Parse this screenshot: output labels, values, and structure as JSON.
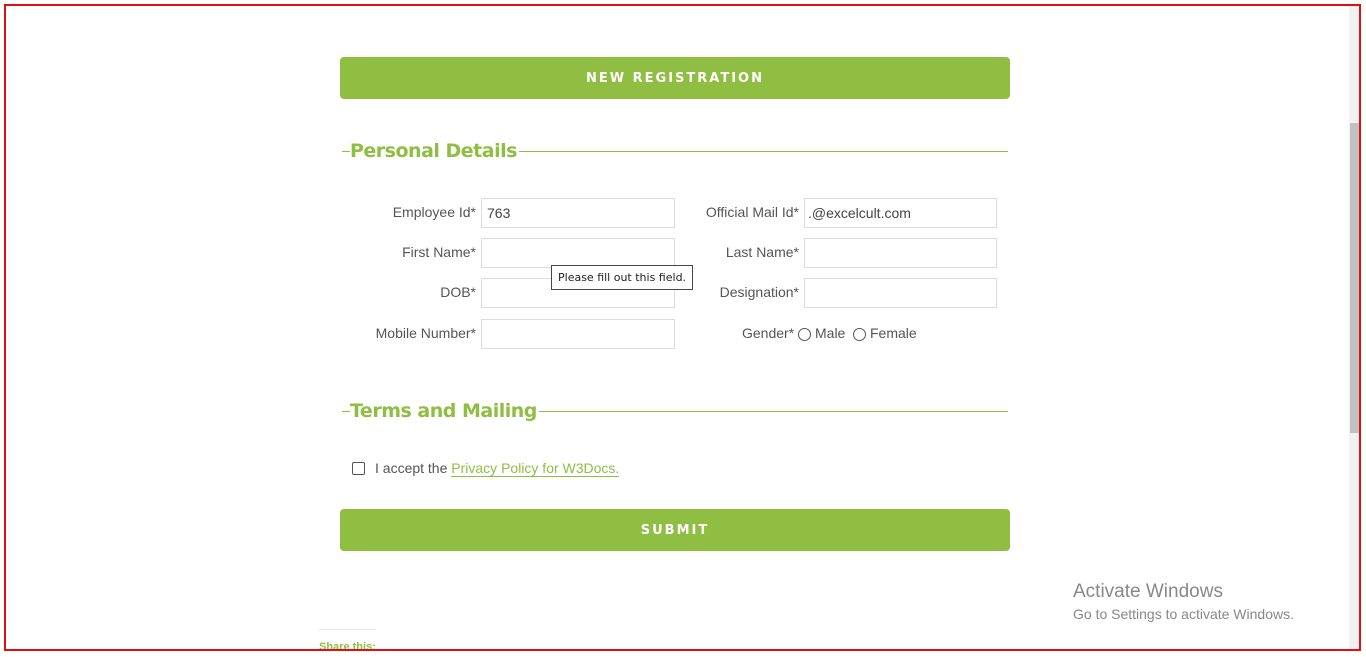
{
  "header_button": "NEW REGISTRATION",
  "personal_section": "Personal Details",
  "fields": {
    "employee_id": {
      "label": "Employee Id*",
      "value": "763"
    },
    "official_mail": {
      "label": "Official Mail Id*",
      "value": ".@excelcult.com"
    },
    "first_name": {
      "label": "First Name*",
      "value": ""
    },
    "last_name": {
      "label": "Last Name*",
      "value": ""
    },
    "dob": {
      "label": "DOB*",
      "value": ""
    },
    "designation": {
      "label": "Designation*",
      "value": ""
    },
    "mobile": {
      "label": "Mobile Number*",
      "value": ""
    },
    "gender": {
      "label": "Gender*",
      "options": [
        "Male",
        "Female"
      ]
    }
  },
  "tooltip": "Please fill out this field.",
  "terms_section": "Terms and Mailing",
  "accept": {
    "prefix": "I accept the",
    "link": "Privacy Policy for W3Docs."
  },
  "submit_button": "SUBMIT",
  "share": "Share this:",
  "watermark": {
    "title": "Activate Windows",
    "subtitle": "Go to Settings to activate Windows."
  },
  "colors": {
    "accent": "#8fbe43",
    "frame": "#e01010"
  }
}
